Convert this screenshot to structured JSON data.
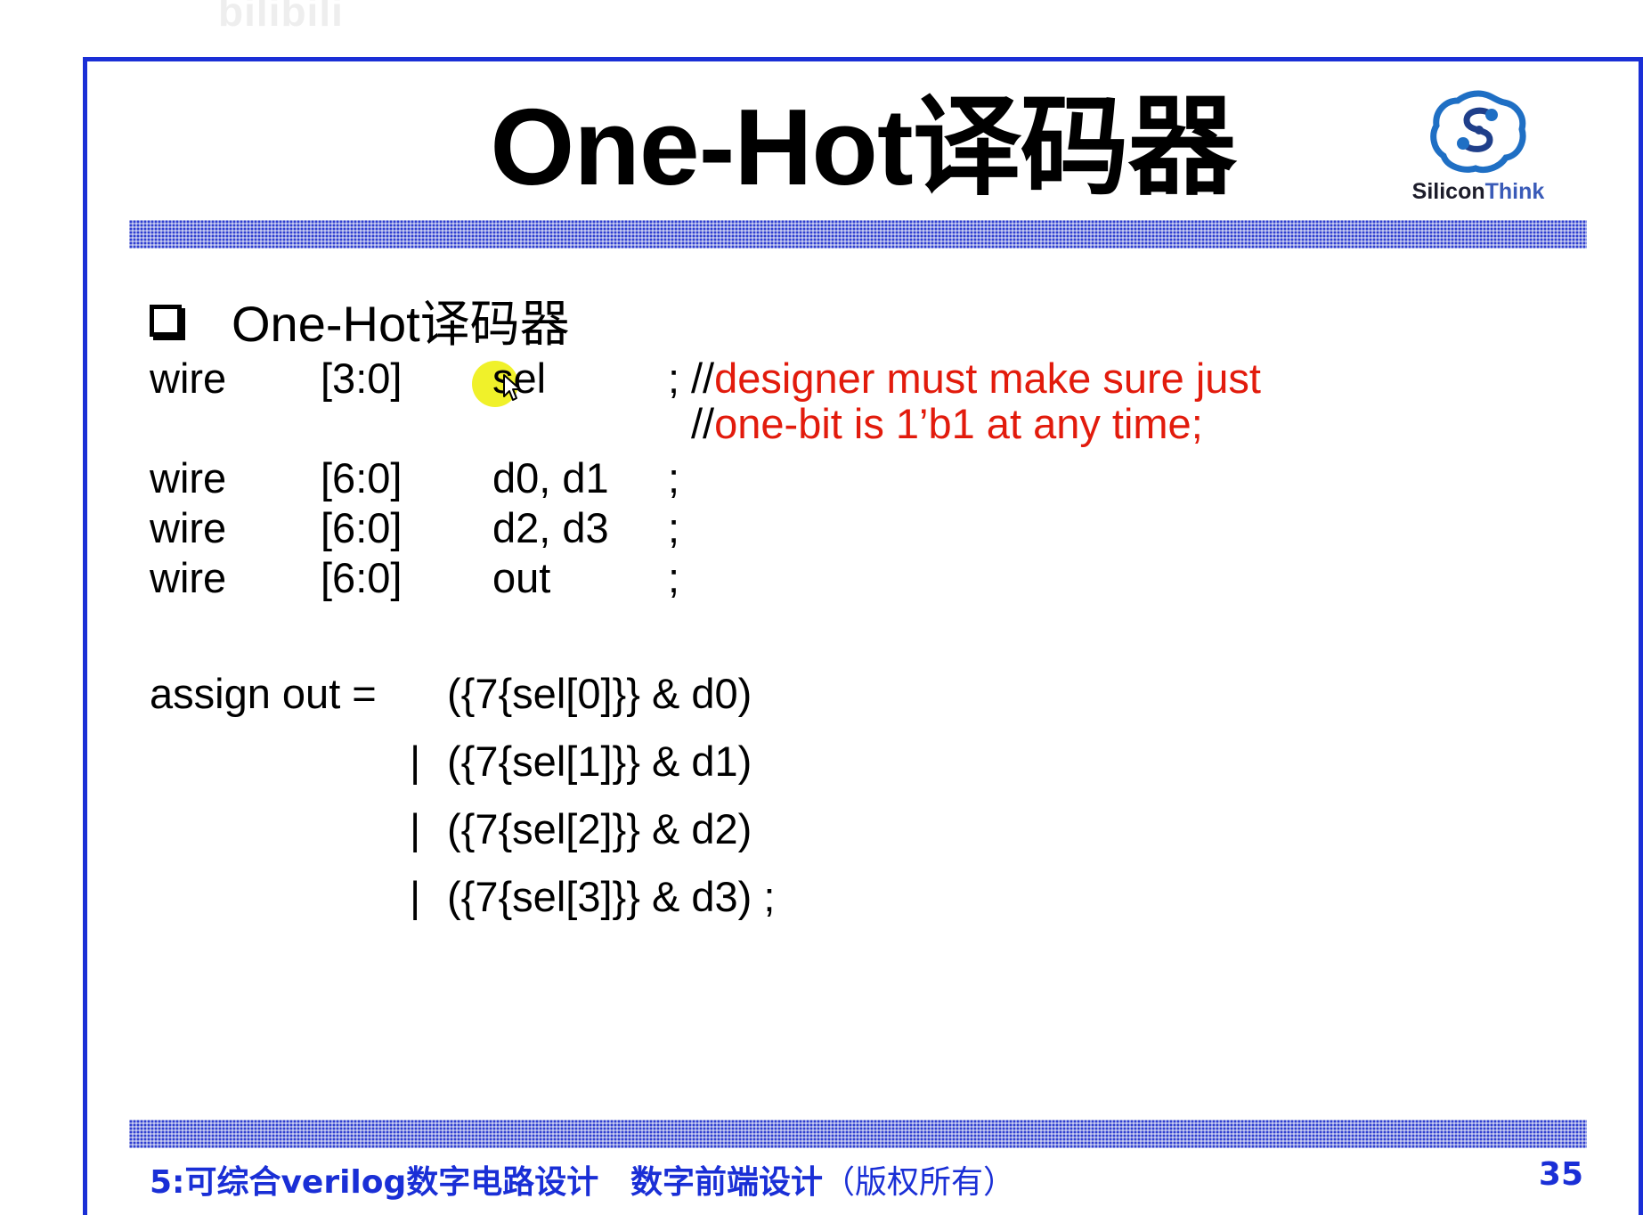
{
  "watermark": "bilibili",
  "slide": {
    "title": "One-Hot译码器",
    "logo_text_a": "Silicon",
    "logo_text_b": "Think",
    "bullet": "One-Hot译码器",
    "code": {
      "sel_line": {
        "kw": "wire",
        "range": "[3:0]",
        "name": "sel",
        "semi": ";",
        "comment_slashes": "//",
        "comment": "designer must make sure just"
      },
      "comment_line2": {
        "slashes": "//",
        "text": "one-bit is 1’b1 at any time;"
      },
      "wire_lines": [
        {
          "kw": "wire",
          "range": "[6:0]",
          "name": "d0, d1",
          "semi": ";"
        },
        {
          "kw": "wire",
          "range": "[6:0]",
          "name": "d2, d3",
          "semi": ";"
        },
        {
          "kw": "wire",
          "range": "[6:0]",
          "name": "out",
          "semi": ";"
        }
      ],
      "assign_lhs": "assign out =",
      "assign_terms": [
        {
          "op": "",
          "expr": "({7{sel[0]}} & d0)"
        },
        {
          "op": "|",
          "expr": "({7{sel[1]}} & d1)"
        },
        {
          "op": "|",
          "expr": "({7{sel[2]}} & d2)"
        },
        {
          "op": "|",
          "expr": "({7{sel[3]}} & d3) ;"
        }
      ]
    },
    "footer": {
      "course": "5:可综合verilog数字电路设计",
      "subtitle": "数字前端设计",
      "rights": "（版权所有）",
      "page": "35"
    }
  },
  "colors": {
    "frame": "#1a2fd6",
    "comment": "#e21b0c",
    "highlight": "#eef013"
  }
}
